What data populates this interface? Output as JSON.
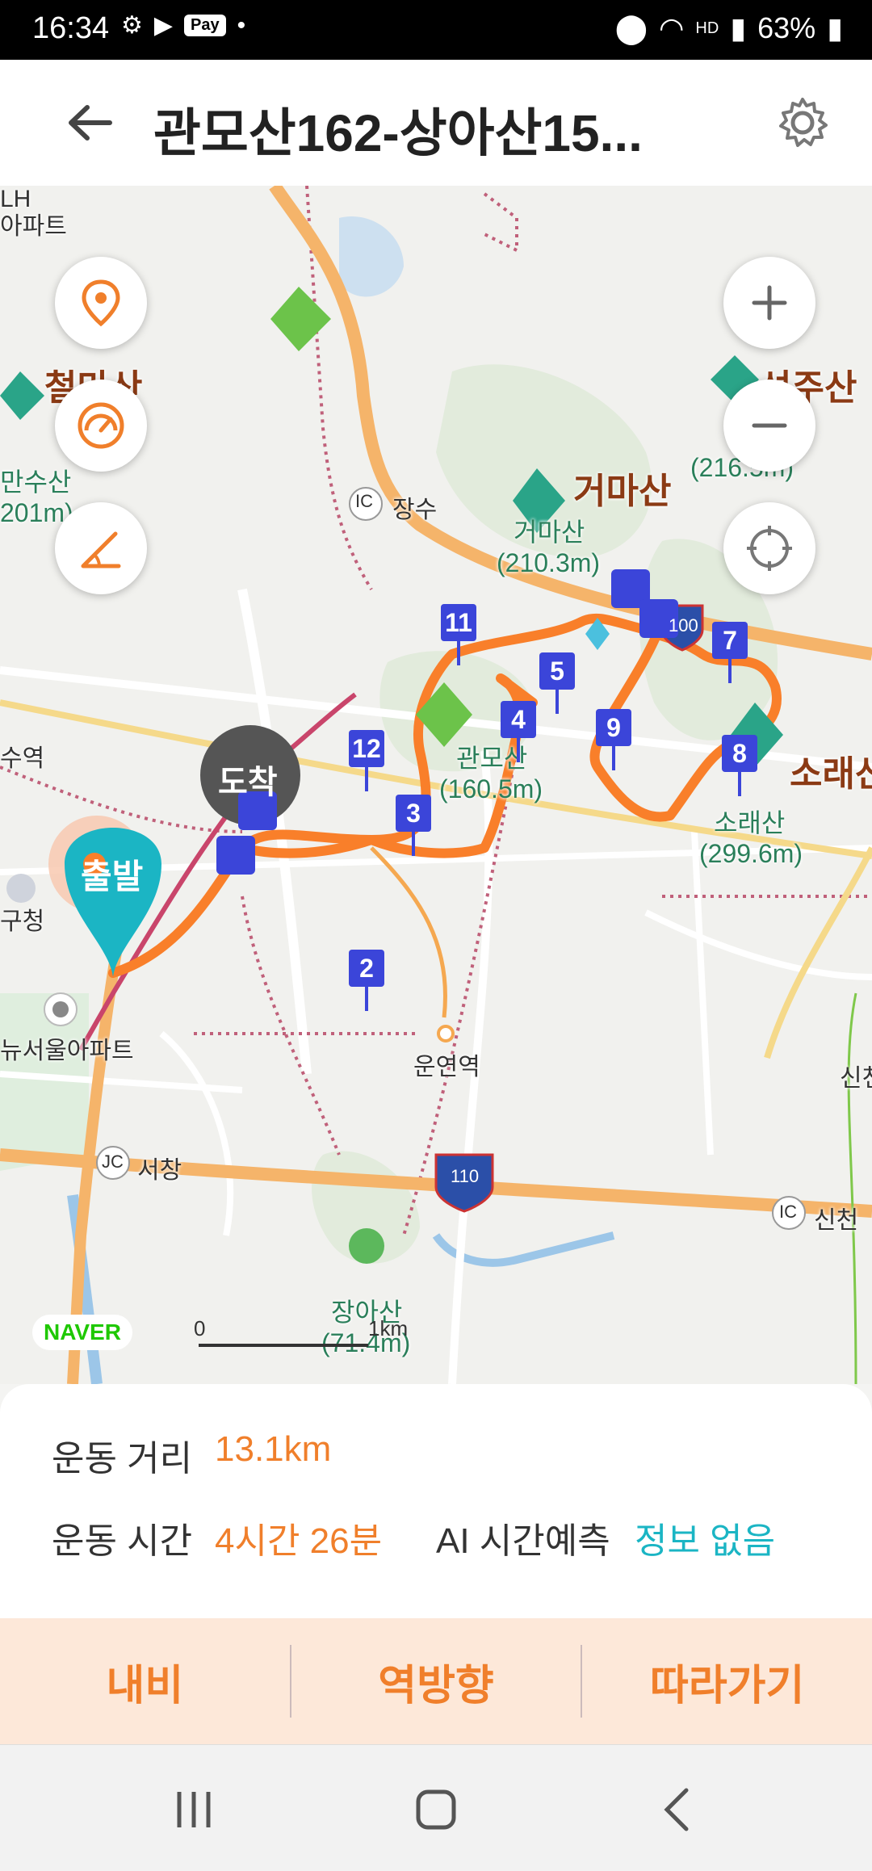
{
  "status_bar": {
    "time": "16:34",
    "icons": [
      "strava-icon",
      "youtube-icon",
      "pay-icon",
      "dot-icon"
    ],
    "pay_label": "Pay",
    "hd_label": "HD",
    "battery": "63%"
  },
  "header": {
    "title": "관모산162-상아산15..."
  },
  "map": {
    "labels": {
      "lh_apt": "LH\n아파트",
      "cheolmasan": "철마산",
      "mansusan": "만수산",
      "mansusan_h": "201m)",
      "jangsu_ic": "IC",
      "jangsu": "장수",
      "geomasan_big": "거마산",
      "geomasan": "거마산",
      "geomasan_h": "(210.3m)",
      "seongjusan": "성주산",
      "seongjusan_h": "(216.5m)",
      "suyeok": "수역",
      "gwanmosan": "관모산",
      "gwanmosan_h": "(160.5m)",
      "soraesan_big": "소래산",
      "soraesan": "소래산",
      "soraesan_h": "(299.6m)",
      "gucheong": "구청",
      "apt": "뉴서울아파트",
      "unyeonyeok": "운연역",
      "seochang_jc": "JC",
      "seochang": "서창",
      "sinchon_ic": "IC",
      "sincheon": "신천",
      "sin": "신천",
      "sangasan": "장아산",
      "sangasan_h": "(71.4m)",
      "hwy_100": "100",
      "hwy_110": "110",
      "arrival": "도착",
      "start": "출발"
    },
    "waypoints": [
      "2",
      "3",
      "4",
      "5",
      "7",
      "8",
      "9",
      "11",
      "12"
    ],
    "scale": {
      "zero": "0",
      "unit": "1km"
    },
    "logo": "NAVER"
  },
  "stats": {
    "distance_label": "운동 거리",
    "distance_value": "13.1km",
    "time_label": "운동 시간",
    "time_value": "4시간 26분",
    "ai_label": "AI 시간예측",
    "ai_value": "정보 없음"
  },
  "actions": {
    "navi": "내비",
    "reverse": "역방향",
    "follow": "따라가기"
  },
  "colors": {
    "accent": "#f07f2b",
    "teal": "#1bb5c4",
    "waypoint": "#3b45d9"
  }
}
